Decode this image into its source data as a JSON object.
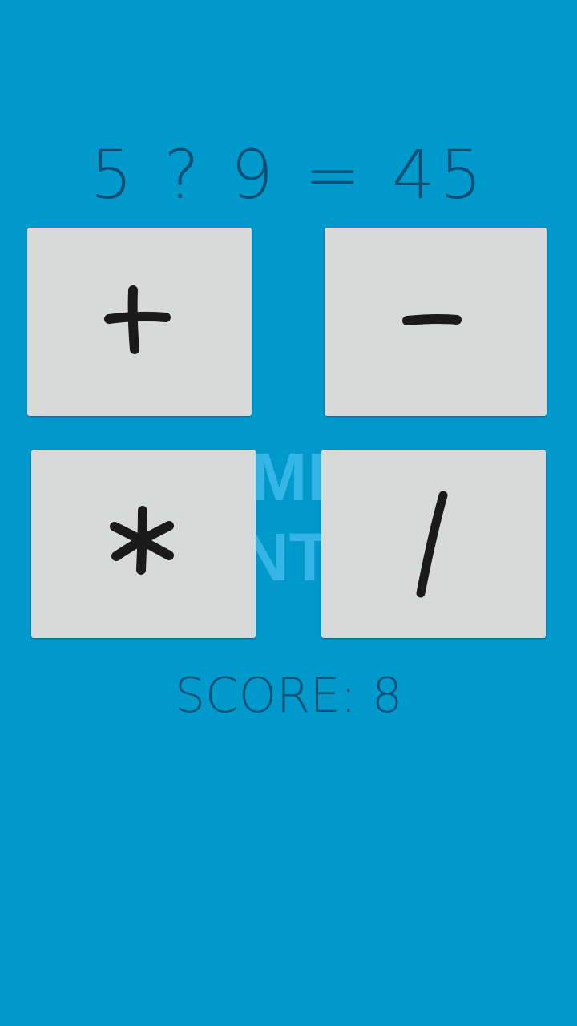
{
  "game": {
    "equation": "5 ? 9 = 45",
    "background_watermark": [
      "MI",
      "NTI"
    ],
    "buttons": [
      {
        "symbol": "+",
        "icon": "plus-icon"
      },
      {
        "symbol": "-",
        "icon": "minus-icon"
      },
      {
        "symbol": "*",
        "icon": "asterisk-icon"
      },
      {
        "symbol": "/",
        "icon": "slash-icon"
      }
    ],
    "score_label": "SCORE: 8"
  },
  "colors": {
    "background": "#0099cc",
    "text": "#0a4f73",
    "button": "#d8d9d9",
    "symbol": "#1a1a1a"
  }
}
